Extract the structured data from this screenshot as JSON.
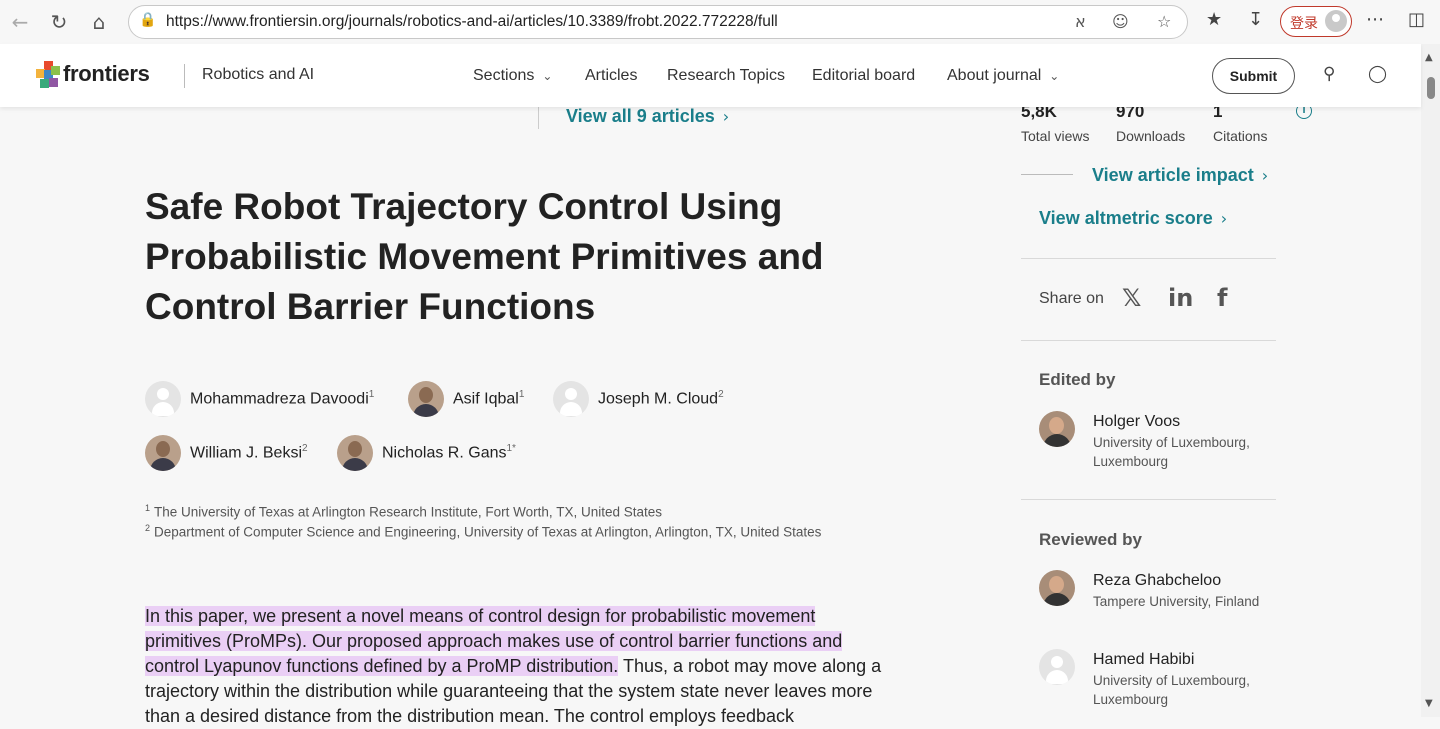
{
  "browser": {
    "url": "https://www.frontiersin.org/journals/robotics-and-ai/articles/10.3389/frobt.2022.772228/full",
    "login_label": "登录"
  },
  "header": {
    "logo_text": "frontiers",
    "journal_name": "Robotics and AI",
    "nav": [
      "Sections",
      "Articles",
      "Research Topics",
      "Editorial board",
      "About journal"
    ],
    "submit_label": "Submit"
  },
  "main": {
    "view_all_label": "View all 9 articles",
    "title": "Safe Robot Trajectory Control Using Probabilistic Movement Primitives and Control Barrier Functions",
    "authors": [
      {
        "name": "Mohammadreza Davoodi",
        "sup": "1"
      },
      {
        "name": "Asif Iqbal",
        "sup": "1"
      },
      {
        "name": "Joseph M. Cloud",
        "sup": "2"
      },
      {
        "name": "William J. Beksi",
        "sup": "2"
      },
      {
        "name": "Nicholas R. Gans",
        "sup": "1*"
      }
    ],
    "affiliations": [
      {
        "num": "1",
        "text": "The University of Texas at Arlington Research Institute, Fort Worth, TX, United States"
      },
      {
        "num": "2",
        "text": "Department of Computer Science and Engineering, University of Texas at Arlington, Arlington, TX, United States"
      }
    ],
    "abstract_highlighted_1": "In this paper, we present a novel means of control design for probabilistic movement",
    "abstract_highlighted_2": "primitives (ProMPs). Our proposed approach makes use of control barrier functions and",
    "abstract_highlighted_3": "control Lyapunov functions defined by a ProMP distribution.",
    "abstract_rest_3": " Thus, a robot may move along a",
    "abstract_line_4": "trajectory within the distribution while guaranteeing that the system state never leaves more",
    "abstract_line_5": "than a desired distance from the distribution mean. The control employs feedback"
  },
  "sidebar": {
    "metrics": [
      {
        "value": "5,8K",
        "label": "Total views"
      },
      {
        "value": "970",
        "label": "Downloads"
      },
      {
        "value": "1",
        "label": "Citations"
      }
    ],
    "impact_link": "View article impact",
    "altmetric_link": "View altmetric score",
    "share_label": "Share on",
    "edited_by_heading": "Edited by",
    "editor": {
      "name": "Holger Voos",
      "affiliation": "University of Luxembourg, Luxembourg"
    },
    "reviewed_by_heading": "Reviewed by",
    "reviewers": [
      {
        "name": "Reza Ghabcheloo",
        "affiliation": "Tampere University, Finland"
      },
      {
        "name": "Hamed Habibi",
        "affiliation": "University of Luxembourg, Luxembourg"
      }
    ]
  },
  "colors": {
    "accent": "#1a7e8a",
    "highlight": "#eacff5",
    "login_red": "#c0392b"
  },
  "icons": [
    "back-icon",
    "refresh-icon",
    "home-icon",
    "lock-icon",
    "read-aloud-icon",
    "emoji-icon",
    "star-icon",
    "favorites-icon",
    "download-icon",
    "more-icon",
    "sidebar-icon",
    "search-icon",
    "user-icon",
    "x-icon",
    "linkedin-icon",
    "facebook-icon",
    "info-icon"
  ]
}
